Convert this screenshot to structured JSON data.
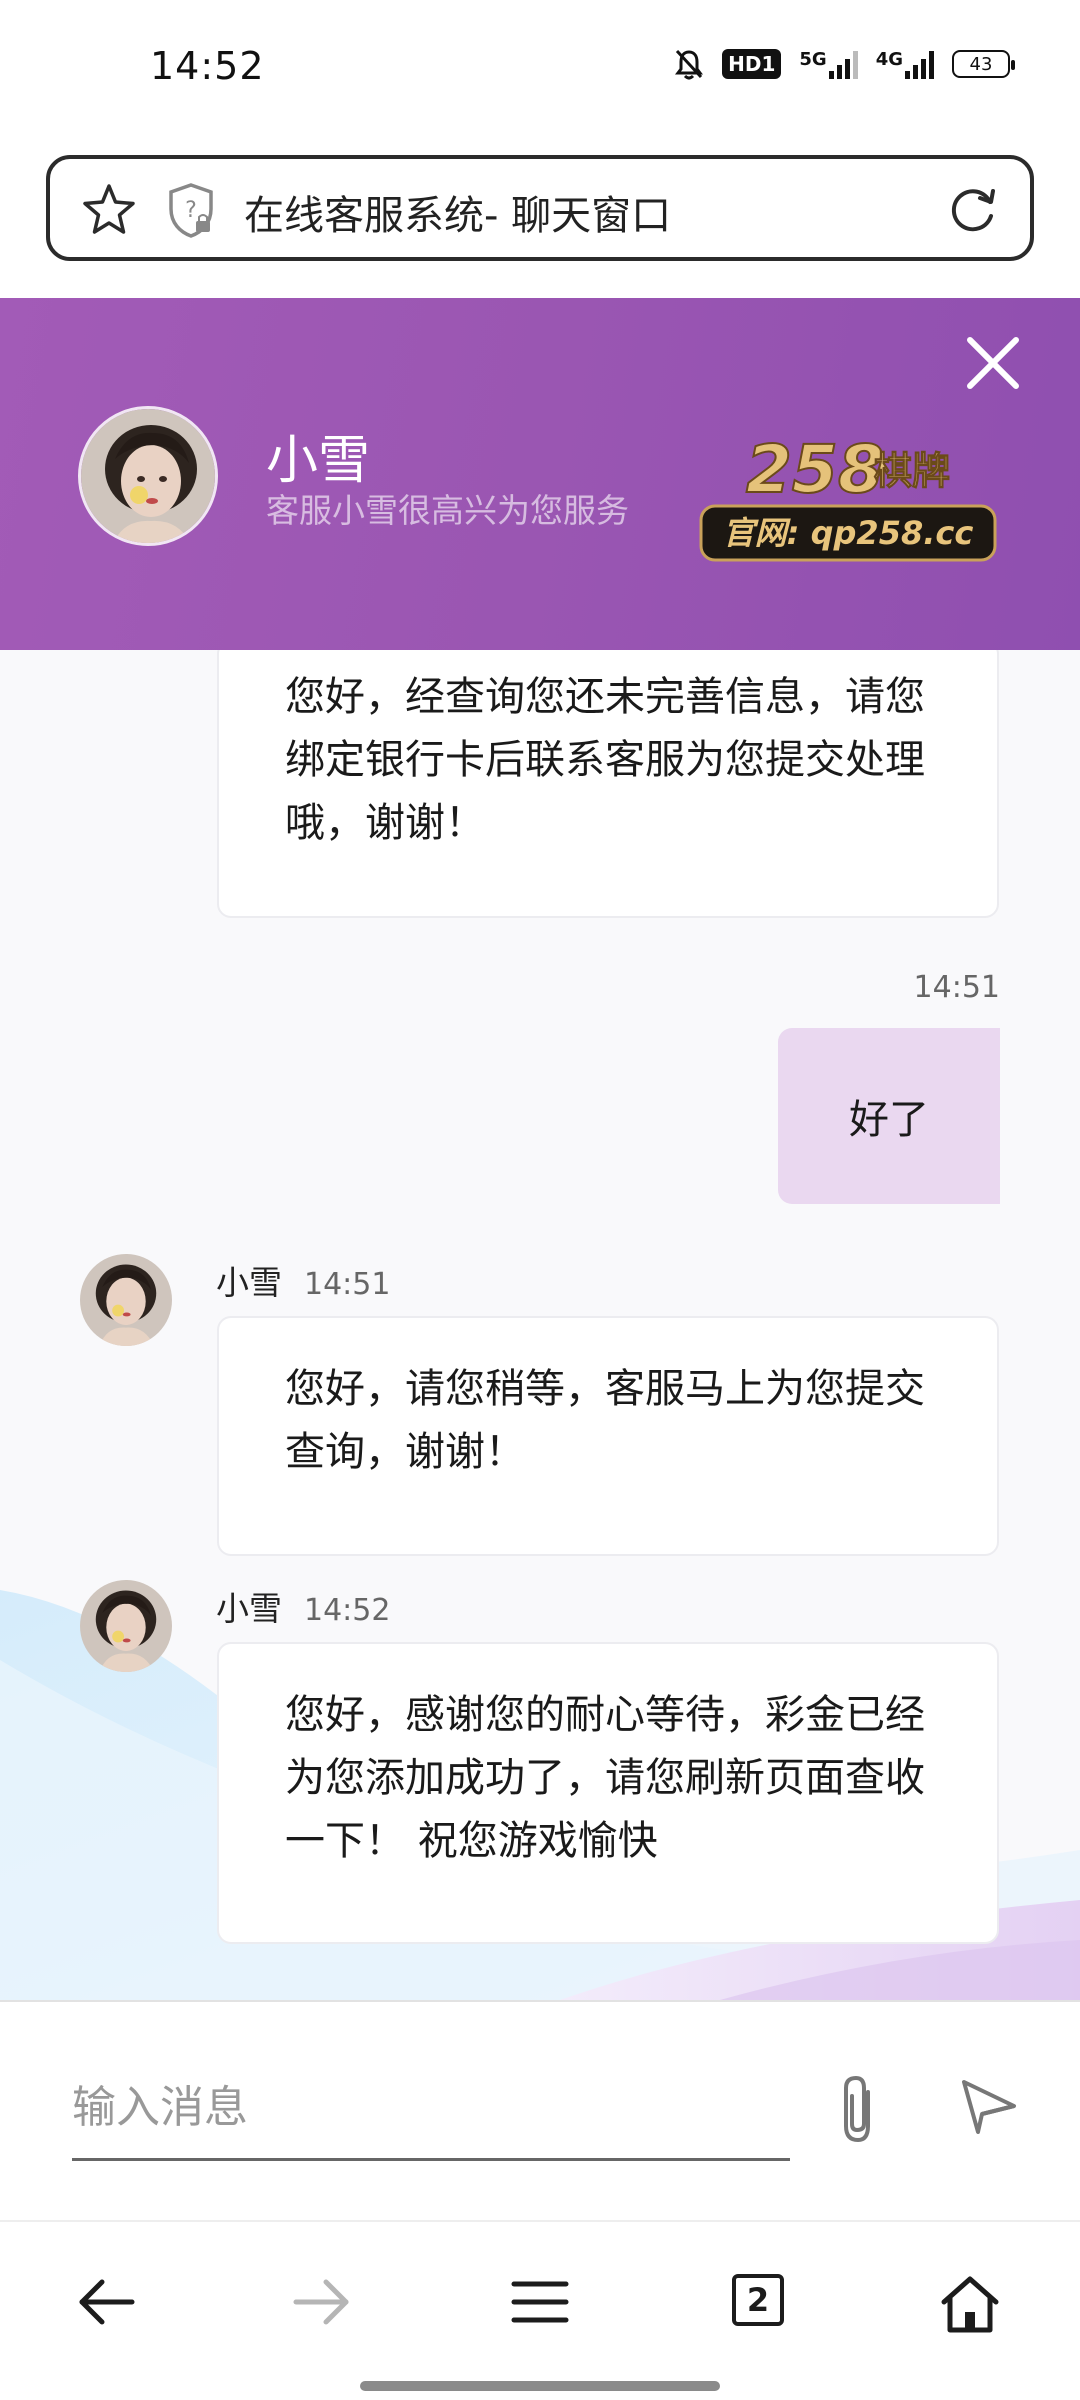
{
  "status_bar": {
    "time": "14:52",
    "network_1": "5G",
    "network_2": "4G",
    "hd_badge": "HD1",
    "battery": "43",
    "icons": [
      "mute-bell-icon",
      "hd-icon",
      "signal-5g-icon",
      "signal-4g-icon",
      "battery-icon"
    ]
  },
  "address_bar": {
    "title": "在线客服系统- 聊天窗口",
    "icons": [
      "star-icon",
      "shield-icon",
      "refresh-icon"
    ]
  },
  "header": {
    "agent_name": "小雪",
    "agent_status": "客服小雪很高兴为您服务",
    "logo_number": "258",
    "logo_chars": "棋牌",
    "logo_site": "官网: qp258.cc",
    "background_color": "#9b57b3"
  },
  "messages": [
    {
      "sender": "agent",
      "text": "您好，经查询您还未完善信息，请您绑定银行卡后联系客服为您提交处理哦，谢谢！"
    },
    {
      "sender": "user",
      "time": "14:51",
      "text": "好了"
    },
    {
      "sender": "agent",
      "name": "小雪",
      "time": "14:51",
      "text": "您好，请您稍等，客服马上为您提交查询，谢谢！"
    },
    {
      "sender": "agent",
      "name": "小雪",
      "time": "14:52",
      "text": "您好，感谢您的耐心等待，彩金已经为您添加成功了，请您刷新页面查收一下！  祝您游戏愉快"
    }
  ],
  "input": {
    "placeholder": "输入消息",
    "value": ""
  },
  "nav_bar": {
    "tab_count": "2",
    "icons": [
      "back-arrow-icon",
      "forward-arrow-icon",
      "menu-icon",
      "tabs-icon",
      "home-icon"
    ]
  },
  "colors": {
    "accent": "#9b57b3",
    "user_bubble": "#ead8f0",
    "text": "#1a1a1a"
  }
}
